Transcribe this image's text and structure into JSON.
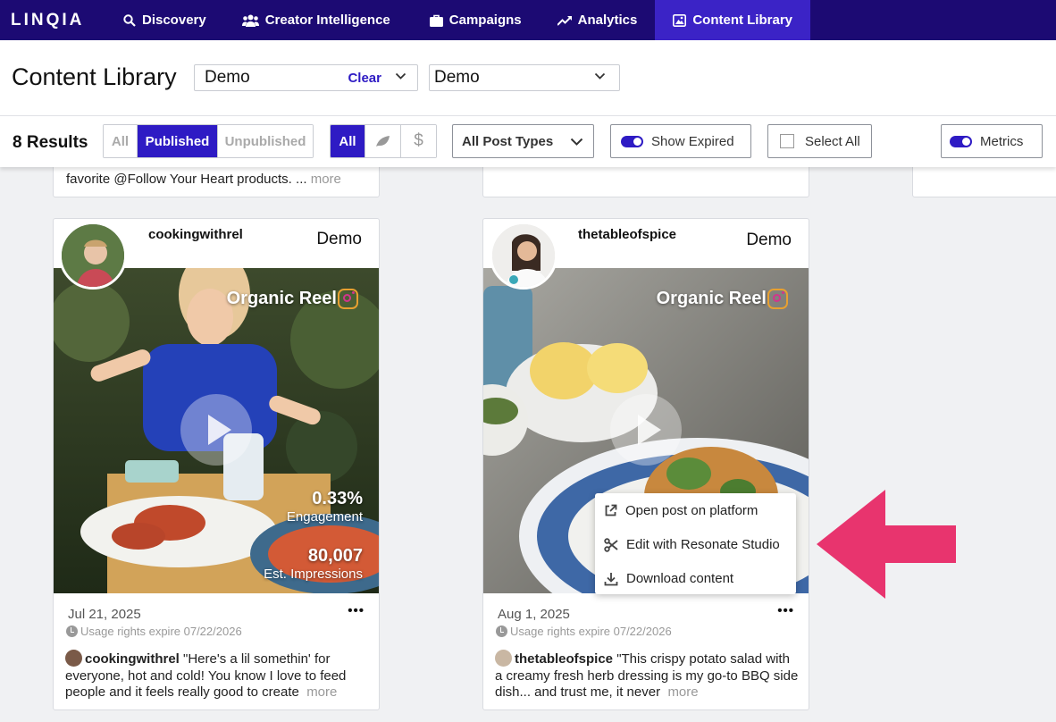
{
  "nav": {
    "logo": "LINQIA",
    "items": [
      {
        "label": "Discovery",
        "icon": "search-icon"
      },
      {
        "label": "Creator Intelligence",
        "icon": "people-icon"
      },
      {
        "label": "Campaigns",
        "icon": "briefcase-icon"
      },
      {
        "label": "Analytics",
        "icon": "trend-icon"
      },
      {
        "label": "Content Library",
        "icon": "image-icon",
        "active": true
      }
    ]
  },
  "header": {
    "title": "Content Library",
    "select1": {
      "value": "Demo",
      "clear": "Clear"
    },
    "select2": {
      "value": "Demo"
    }
  },
  "filters": {
    "results": "8 Results",
    "status": [
      "All",
      "Published",
      "Unpublished"
    ],
    "status_selected": "Published",
    "type_all": "All",
    "post_types": "All Post Types",
    "show_expired": "Show Expired",
    "select_all": "Select All",
    "metrics": "Metrics"
  },
  "prev_card": {
    "text": "favorite  @Follow Your Heart products.",
    "ellipsis": " ... ",
    "more": "more"
  },
  "cards": [
    {
      "username": "cookingwithrel",
      "brand": "Demo",
      "post_type": "Organic Reel",
      "engagement_value": "0.33%",
      "engagement_label": "Engagement",
      "impressions_value": "80,007",
      "impressions_label": "Est. Impressions",
      "date": "Jul 21, 2025",
      "rights": "Usage rights expire 07/22/2026",
      "caption_user": "cookingwithrel",
      "caption": " \"Here's a lil somethin' for everyone, hot and cold! You know I love to feed people and it feels really good to create",
      "more": "more"
    },
    {
      "username": "thetableofspice",
      "brand": "Demo",
      "post_type": "Organic Reel",
      "date": "Aug 1, 2025",
      "rights": "Usage rights expire 07/22/2026",
      "caption_user": "thetableofspice",
      "caption": " \"This crispy potato salad with a creamy fresh herb dressing is my go-to BBQ side dish... and trust me, it never",
      "more": "more"
    }
  ],
  "context_menu": [
    {
      "label": "Open post on platform",
      "icon": "external-link-icon"
    },
    {
      "label": "Edit with Resonate Studio",
      "icon": "scissors-icon"
    },
    {
      "label": "Download content",
      "icon": "download-icon"
    }
  ],
  "colors": {
    "nav_bg": "#1c0a73",
    "nav_active": "#3b23c6",
    "accent": "#2e1bc4",
    "arrow": "#e8346e"
  }
}
